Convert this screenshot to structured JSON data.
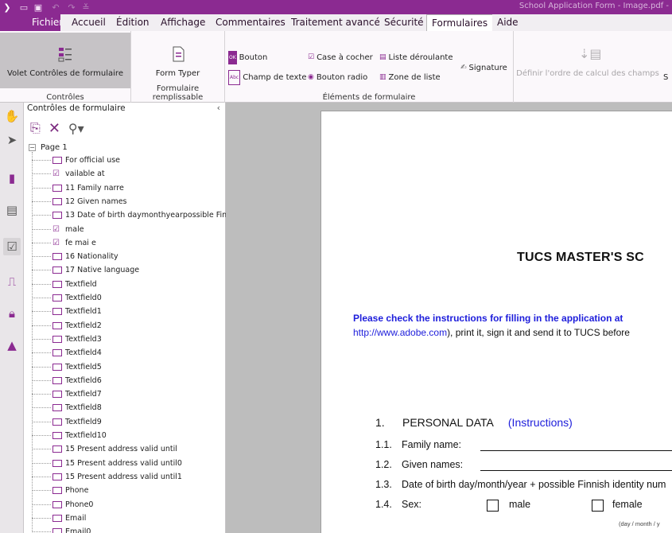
{
  "titlebar": {
    "logo": "❯",
    "quick_access_icons": [
      "open-icon",
      "save-icon",
      "undo-icon",
      "redo-icon",
      "customize-icon"
    ],
    "title": "School Application Form - Image.pdf -"
  },
  "menu": {
    "file": "Fichier",
    "tabs": [
      "Accueil",
      "Édition",
      "Affichage",
      "Commentaires",
      "Traitement avancé",
      "Sécurité",
      "Formulaires",
      "Aide"
    ],
    "active_tab": "Formulaires"
  },
  "ribbon": {
    "controls_button": "Volet Contrôles de formulaire",
    "controls_caption": "Contrôles",
    "form_typer_button": "Form Typer",
    "fillable_caption": "Formulaire remplissable",
    "elements": {
      "button": "Bouton",
      "text_field": "Champ de texte",
      "checkbox": "Case à cocher",
      "radio": "Bouton radio",
      "dropdown": "Liste déroulante",
      "list_box": "Zone de liste",
      "signature": "Signature"
    },
    "elements_caption": "Éléments de formulaire",
    "calc_order": "Définir l'ordre de calcul des champs",
    "overflow_label": "S"
  },
  "panel": {
    "header": "Contrôles de formulaire",
    "collapse": "‹",
    "root": "Page 1",
    "items": [
      {
        "label": "For official use",
        "type": "text"
      },
      {
        "label": "vailable at",
        "type": "check"
      },
      {
        "label": "11 Family narre",
        "type": "text"
      },
      {
        "label": "12 Given names",
        "type": "text"
      },
      {
        "label": "13 Date of birth daymonthyearpossible Fin",
        "type": "text"
      },
      {
        "label": "male",
        "type": "check"
      },
      {
        "label": "fe mai e",
        "type": "check"
      },
      {
        "label": "16 Nationality",
        "type": "text"
      },
      {
        "label": "17 Native language",
        "type": "text"
      },
      {
        "label": "Textfield",
        "type": "text"
      },
      {
        "label": "Textfield0",
        "type": "text"
      },
      {
        "label": "Textfield1",
        "type": "text"
      },
      {
        "label": "Textfield2",
        "type": "text"
      },
      {
        "label": "Textfield3",
        "type": "text"
      },
      {
        "label": "Textfield4",
        "type": "text"
      },
      {
        "label": "Textfield5",
        "type": "text"
      },
      {
        "label": "Textfield6",
        "type": "text"
      },
      {
        "label": "Textfield7",
        "type": "text"
      },
      {
        "label": "Textfield8",
        "type": "text"
      },
      {
        "label": "Textfield9",
        "type": "text"
      },
      {
        "label": "Textfield10",
        "type": "text"
      },
      {
        "label": "15 Present address valid until",
        "type": "text"
      },
      {
        "label": "15 Present address valid until0",
        "type": "text"
      },
      {
        "label": "15 Present address valid until1",
        "type": "text"
      },
      {
        "label": "Phone",
        "type": "text"
      },
      {
        "label": "Phone0",
        "type": "text"
      },
      {
        "label": "Email",
        "type": "text"
      },
      {
        "label": "Email0",
        "type": "text"
      }
    ]
  },
  "document": {
    "title": "TUCS MASTER'S SC",
    "instructions_line1": "Please check the instructions for filling in the application at",
    "instructions_link": "http://www.adobe.com",
    "instructions_line2": "), print it, sign it and send it to TUCS before",
    "section_num": "1.",
    "section_title": "PERSONAL DATA",
    "section_link": "(Instructions)",
    "rows": [
      {
        "num": "1.1.",
        "label": "Family name:"
      },
      {
        "num": "1.2.",
        "label": "Given names:"
      },
      {
        "num": "1.3.",
        "label": "Date of birth day/month/year + possible Finnish identity num"
      },
      {
        "num": "1.4.",
        "label": "Sex:"
      }
    ],
    "sex_options": [
      "male",
      "female"
    ],
    "date_hint": "(day / month / y"
  }
}
